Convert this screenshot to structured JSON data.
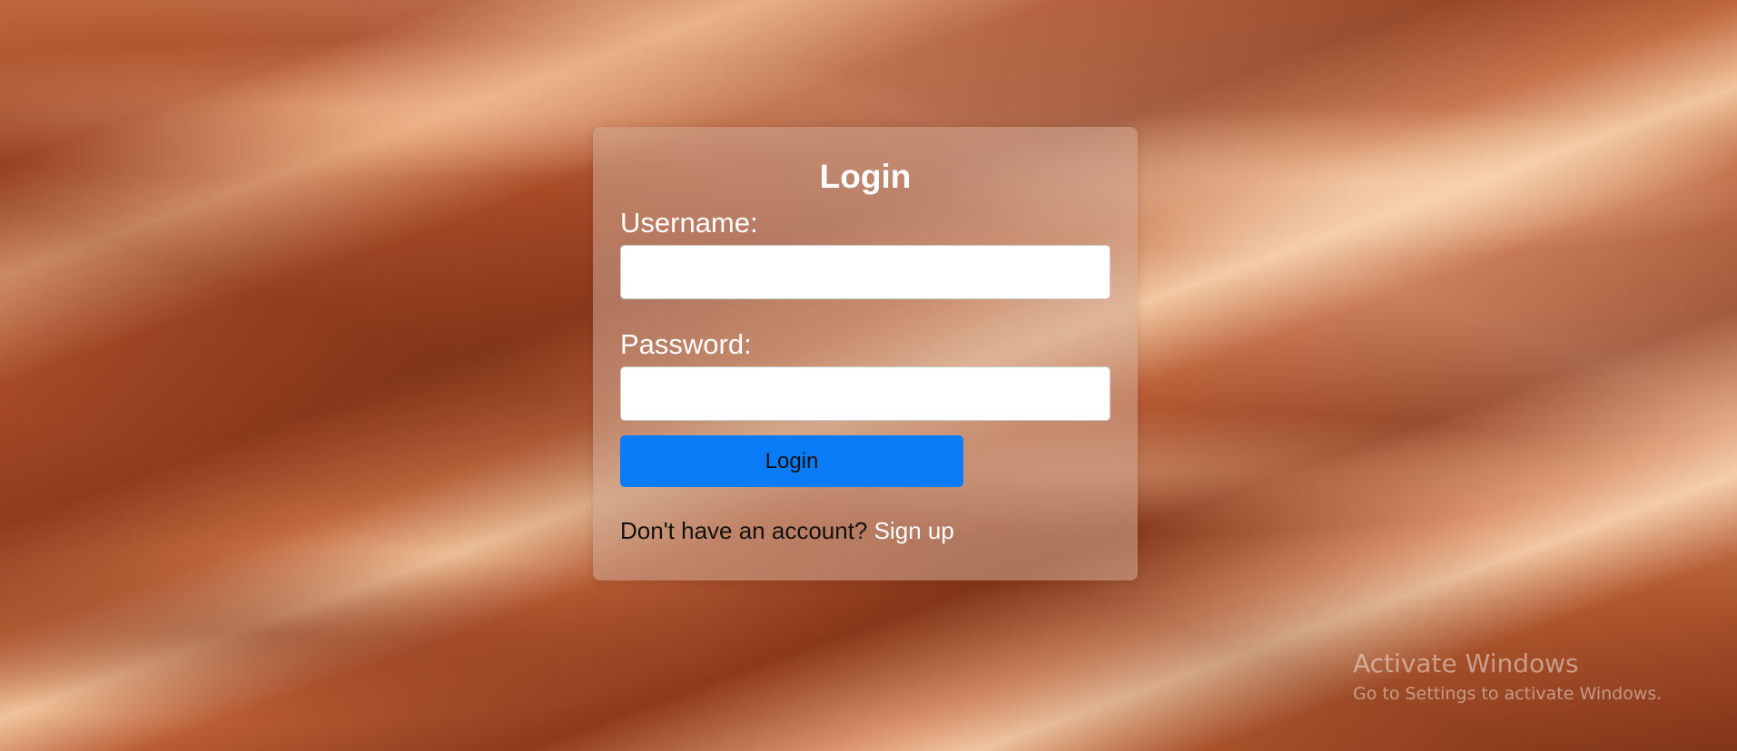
{
  "login_form": {
    "title": "Login",
    "username_label": "Username:",
    "username_value": "",
    "password_label": "Password:",
    "password_value": "",
    "login_button_label": "Login",
    "signup_prompt": "Don't have an account?",
    "signup_link_label": "Sign up"
  },
  "watermark": {
    "title": "Activate Windows",
    "subtitle": "Go to Settings to activate Windows."
  },
  "colors": {
    "login_button": "#0b7cf7",
    "card_tint": "#d2aa96",
    "background": "#a84f2c"
  }
}
